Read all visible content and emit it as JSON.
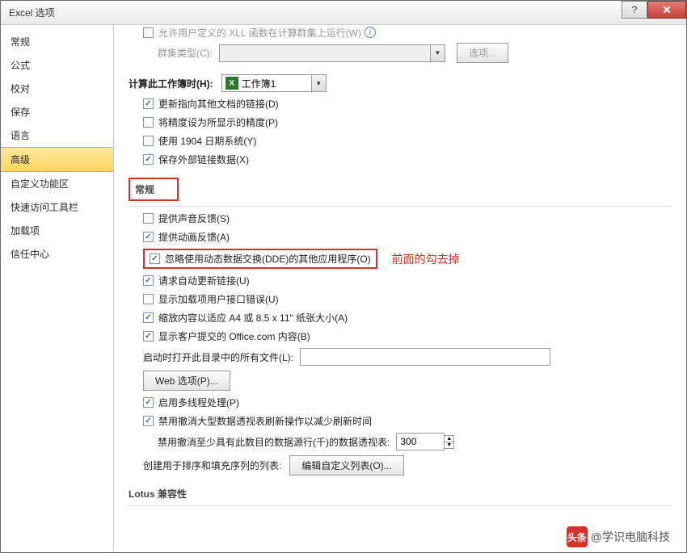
{
  "window": {
    "title": "Excel 选项",
    "help_tooltip": "?",
    "close_tooltip": "✕"
  },
  "sidebar": {
    "items": [
      {
        "label": "常规"
      },
      {
        "label": "公式"
      },
      {
        "label": "校对"
      },
      {
        "label": "保存"
      },
      {
        "label": "语言"
      },
      {
        "label": "高级",
        "selected": true
      },
      {
        "label": "自定义功能区"
      },
      {
        "label": "快速访问工具栏"
      },
      {
        "label": "加载项"
      },
      {
        "label": "信任中心"
      }
    ]
  },
  "top_cut": {
    "xll_label": "允许用户定义的 XLL 函数在计算群集上运行(W)",
    "cluster_label": "群集类型(C):",
    "options_btn": "选项..."
  },
  "workbook": {
    "calc_label": "计算此工作簿时(H):",
    "workbook_name": "工作簿1",
    "opts": [
      {
        "checked": true,
        "label": "更新指向其他文档的链接(D)"
      },
      {
        "checked": false,
        "label": "将精度设为所显示的精度(P)"
      },
      {
        "checked": false,
        "label": "使用 1904 日期系统(Y)"
      },
      {
        "checked": true,
        "label": "保存外部链接数据(X)"
      }
    ]
  },
  "general": {
    "header": "常规",
    "opts": [
      {
        "checked": false,
        "label": "提供声音反馈(S)"
      },
      {
        "checked": true,
        "label": "提供动画反馈(A)"
      },
      {
        "checked": true,
        "label": "忽略使用动态数据交换(DDE)的其他应用程序(O)",
        "highlight": true
      },
      {
        "checked": true,
        "label": "请求自动更新链接(U)"
      },
      {
        "checked": false,
        "label": "显示加载项用户接口错误(U)"
      },
      {
        "checked": true,
        "label": "缩放内容以适应 A4 或 8.5 x 11\" 纸张大小(A)"
      },
      {
        "checked": true,
        "label": "显示客户提交的 Office.com 内容(B)"
      }
    ],
    "annotation": "前面的勾去掉",
    "startup_label": "启动时打开此目录中的所有文件(L):",
    "web_btn": "Web 选项(P)...",
    "multithread": {
      "checked": true,
      "label": "启用多线程处理(P)"
    },
    "pivot_disable": {
      "checked": true,
      "label": "禁用撤消大型数据透视表刷新操作以减少刷新时间"
    },
    "pivot_rows_label": "禁用撤消至少具有此数目的数据源行(千)的数据透视表:",
    "pivot_rows_value": "300",
    "custom_list_label": "创建用于排序和填充序列的列表:",
    "custom_list_btn": "编辑自定义列表(O)..."
  },
  "lotus": {
    "header": "Lotus 兼容性"
  },
  "watermark": {
    "prefix": "头条",
    "text": "@学识电脑科技"
  }
}
